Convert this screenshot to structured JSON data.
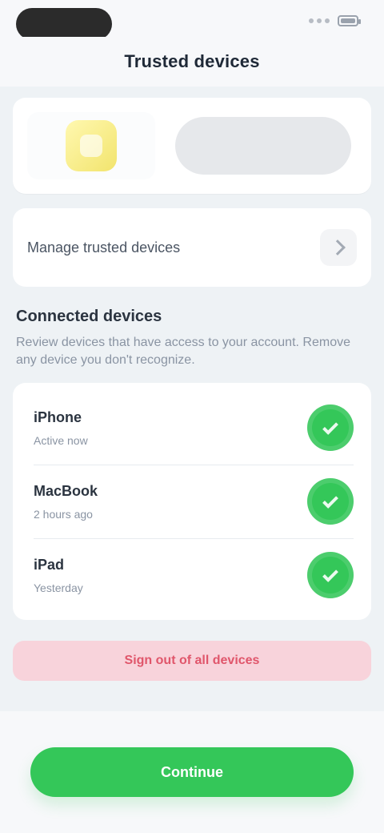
{
  "header": {
    "title": "Trusted devices"
  },
  "status_bar": {
    "time": "",
    "battery_label": ""
  },
  "hero": {
    "icon_name": "device-icon",
    "pill_text": ""
  },
  "settings": {
    "manage_row_label": "Manage trusted devices"
  },
  "section": {
    "title": "Connected devices",
    "description": "Review devices that have access to your account. Remove any device you don't recognize."
  },
  "devices": [
    {
      "title": "iPhone",
      "subtitle": "Active now",
      "status": "on"
    },
    {
      "title": "MacBook",
      "subtitle": "2 hours ago",
      "status": "on"
    },
    {
      "title": "iPad",
      "subtitle": "Yesterday",
      "status": "on"
    }
  ],
  "actions": {
    "danger_label": "Sign out of all devices",
    "primary_label": "Continue"
  },
  "colors": {
    "accent_green": "#34c759",
    "danger_pink": "#f8d3db",
    "background": "#eef2f5"
  }
}
